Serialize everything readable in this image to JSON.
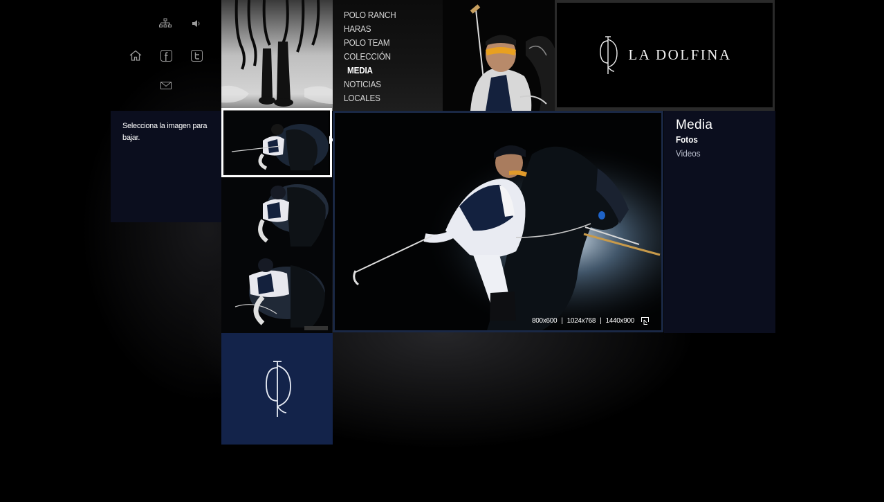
{
  "brand": {
    "name": "LA DOLFINA"
  },
  "utility_icons": [
    {
      "name": "sitemap-icon"
    },
    {
      "name": "speaker-icon"
    },
    {
      "name": "home-icon"
    },
    {
      "name": "facebook-icon"
    },
    {
      "name": "twitter-icon"
    },
    {
      "name": "mail-icon"
    }
  ],
  "nav": {
    "items": [
      {
        "label": "POLO RANCH"
      },
      {
        "label": "HARAS"
      },
      {
        "label": "POLO TEAM"
      },
      {
        "label": "COLECCIÓN"
      },
      {
        "label": "MEDIA",
        "active": true
      },
      {
        "label": "NOTICIAS"
      },
      {
        "label": "LOCALES"
      }
    ]
  },
  "info": {
    "text": "Selecciona la imagen para bajar."
  },
  "viewer": {
    "downloads": [
      {
        "label": "800x600"
      },
      {
        "label": "1024x768"
      },
      {
        "label": "1440x900"
      }
    ],
    "separator": "|"
  },
  "media_panel": {
    "title": "Media",
    "links": [
      {
        "label": "Fotos",
        "active": true
      },
      {
        "label": "Videos",
        "active": false
      }
    ]
  },
  "colors": {
    "panel_navy": "#0b0e1e",
    "logo_tile_blue": "#13234a",
    "viewer_border": "#1a2845",
    "background": "#000000"
  }
}
